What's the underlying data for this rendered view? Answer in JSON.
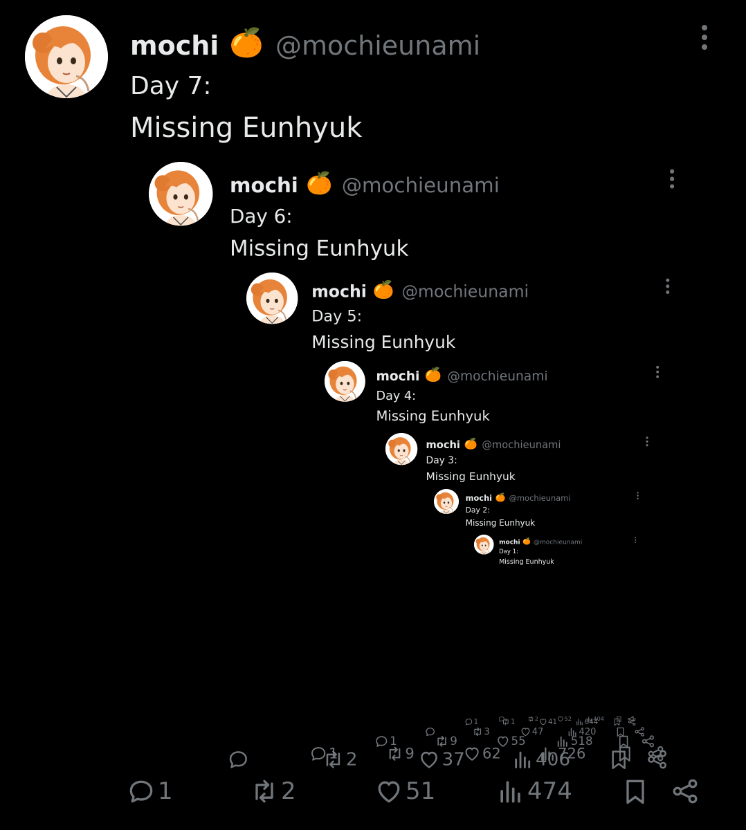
{
  "accent_color": "#71767b",
  "text_color": "#e7e9ea",
  "background_color": "#000000",
  "posts": [
    {
      "author_name": "mochi",
      "name_emoji": "🍊",
      "handle": "@mochieunami",
      "line1": "Day 7:",
      "line2": "Missing Eunhyuk",
      "replies": "1",
      "reposts": "2",
      "likes": "51",
      "views": "474",
      "icons": [
        "reply-icon",
        "repost-icon",
        "like-icon",
        "views-icon",
        "bookmark-icon",
        "share-icon"
      ]
    },
    {
      "author_name": "mochi",
      "name_emoji": "🍊",
      "handle": "@mochieunami",
      "line1": "Day 6:",
      "line2": "Missing Eunhyuk",
      "replies": "",
      "reposts": "2",
      "likes": "37",
      "views": "406"
    },
    {
      "author_name": "mochi",
      "name_emoji": "🍊",
      "handle": "@mochieunami",
      "line1": "Day 5:",
      "line2": "Missing Eunhyuk",
      "replies": "1",
      "reposts": "9",
      "likes": "62",
      "views": "726"
    },
    {
      "author_name": "mochi",
      "name_emoji": "🍊",
      "handle": "@mochieunami",
      "line1": "Day 4:",
      "line2": "Missing Eunhyuk",
      "replies": "1",
      "reposts": "9",
      "likes": "55",
      "views": "518"
    },
    {
      "author_name": "mochi",
      "name_emoji": "🍊",
      "handle": "@mochieunami",
      "line1": "Day 3:",
      "line2": "Missing Eunhyuk",
      "replies": "",
      "reposts": "3",
      "likes": "47",
      "views": "420"
    },
    {
      "author_name": "mochi",
      "name_emoji": "🍊",
      "handle": "@mochieunami",
      "line1": "Day 2:",
      "line2": "Missing Eunhyuk",
      "replies": "1",
      "reposts": "1",
      "likes": "41",
      "views": "644"
    },
    {
      "author_name": "mochi",
      "name_emoji": "🍊",
      "handle": "@mochieunami",
      "line1": "Day 1:",
      "line2": "Missing Eunhyuk",
      "replies": "",
      "reposts": "2",
      "likes": "52",
      "views": "404"
    }
  ]
}
